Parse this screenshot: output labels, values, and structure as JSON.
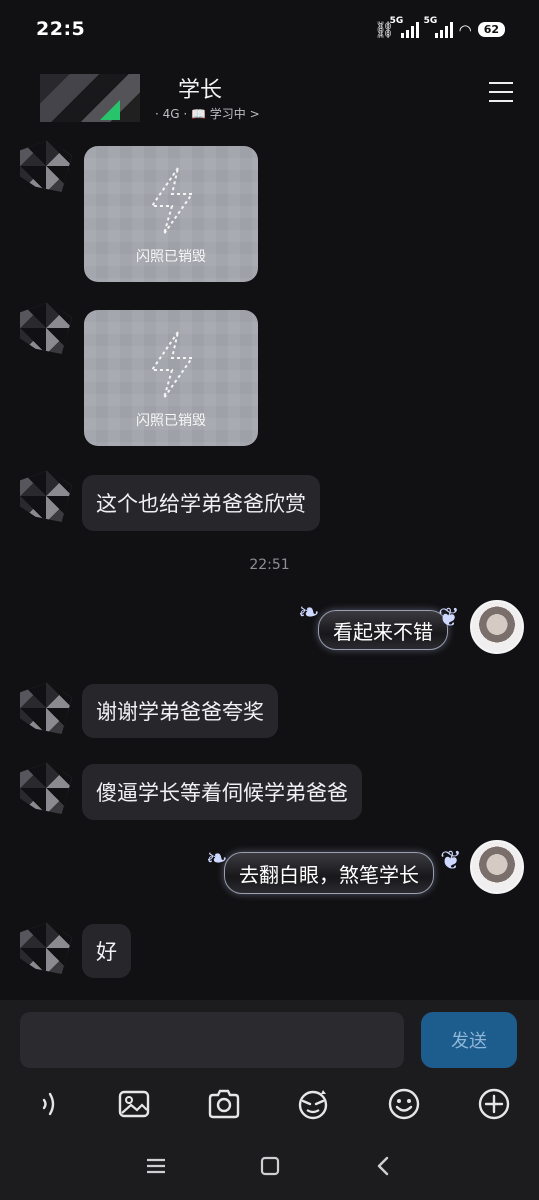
{
  "status_bar": {
    "time": "22:5",
    "network_1": "5G",
    "network_2": "5G",
    "battery": "62"
  },
  "header": {
    "contact_name": "学长",
    "status": "· 4G · 📖 学习中 >"
  },
  "messages": [
    {
      "type": "flash",
      "direction": "in",
      "caption": "闪照已销毁"
    },
    {
      "type": "flash",
      "direction": "in",
      "caption": "闪照已销毁"
    },
    {
      "type": "text",
      "direction": "in",
      "text": "这个也给学弟爸爸欣赏"
    },
    {
      "type": "timestamp",
      "text": "22:51"
    },
    {
      "type": "text",
      "direction": "out",
      "text": "看起来不错"
    },
    {
      "type": "text",
      "direction": "in",
      "text": "谢谢学弟爸爸夸奖"
    },
    {
      "type": "text",
      "direction": "in",
      "text": "傻逼学长等着伺候学弟爸爸"
    },
    {
      "type": "text",
      "direction": "out",
      "text": "去翻白眼，煞笔学长"
    },
    {
      "type": "text",
      "direction": "in",
      "text": "好"
    }
  ],
  "input": {
    "value": "",
    "placeholder": "",
    "send_label": "发送"
  },
  "toolbar": {
    "icons": [
      "voice-icon",
      "image-icon",
      "camera-icon",
      "sticker-icon",
      "emoji-icon",
      "plus-icon"
    ]
  },
  "nav": {
    "icons": [
      "menu-icon",
      "home-icon",
      "back-icon"
    ]
  },
  "colors": {
    "background": "#111113",
    "bubble_in": "#27272b",
    "send_button": "#1d5d8e",
    "online_dot": "#27c46b"
  }
}
